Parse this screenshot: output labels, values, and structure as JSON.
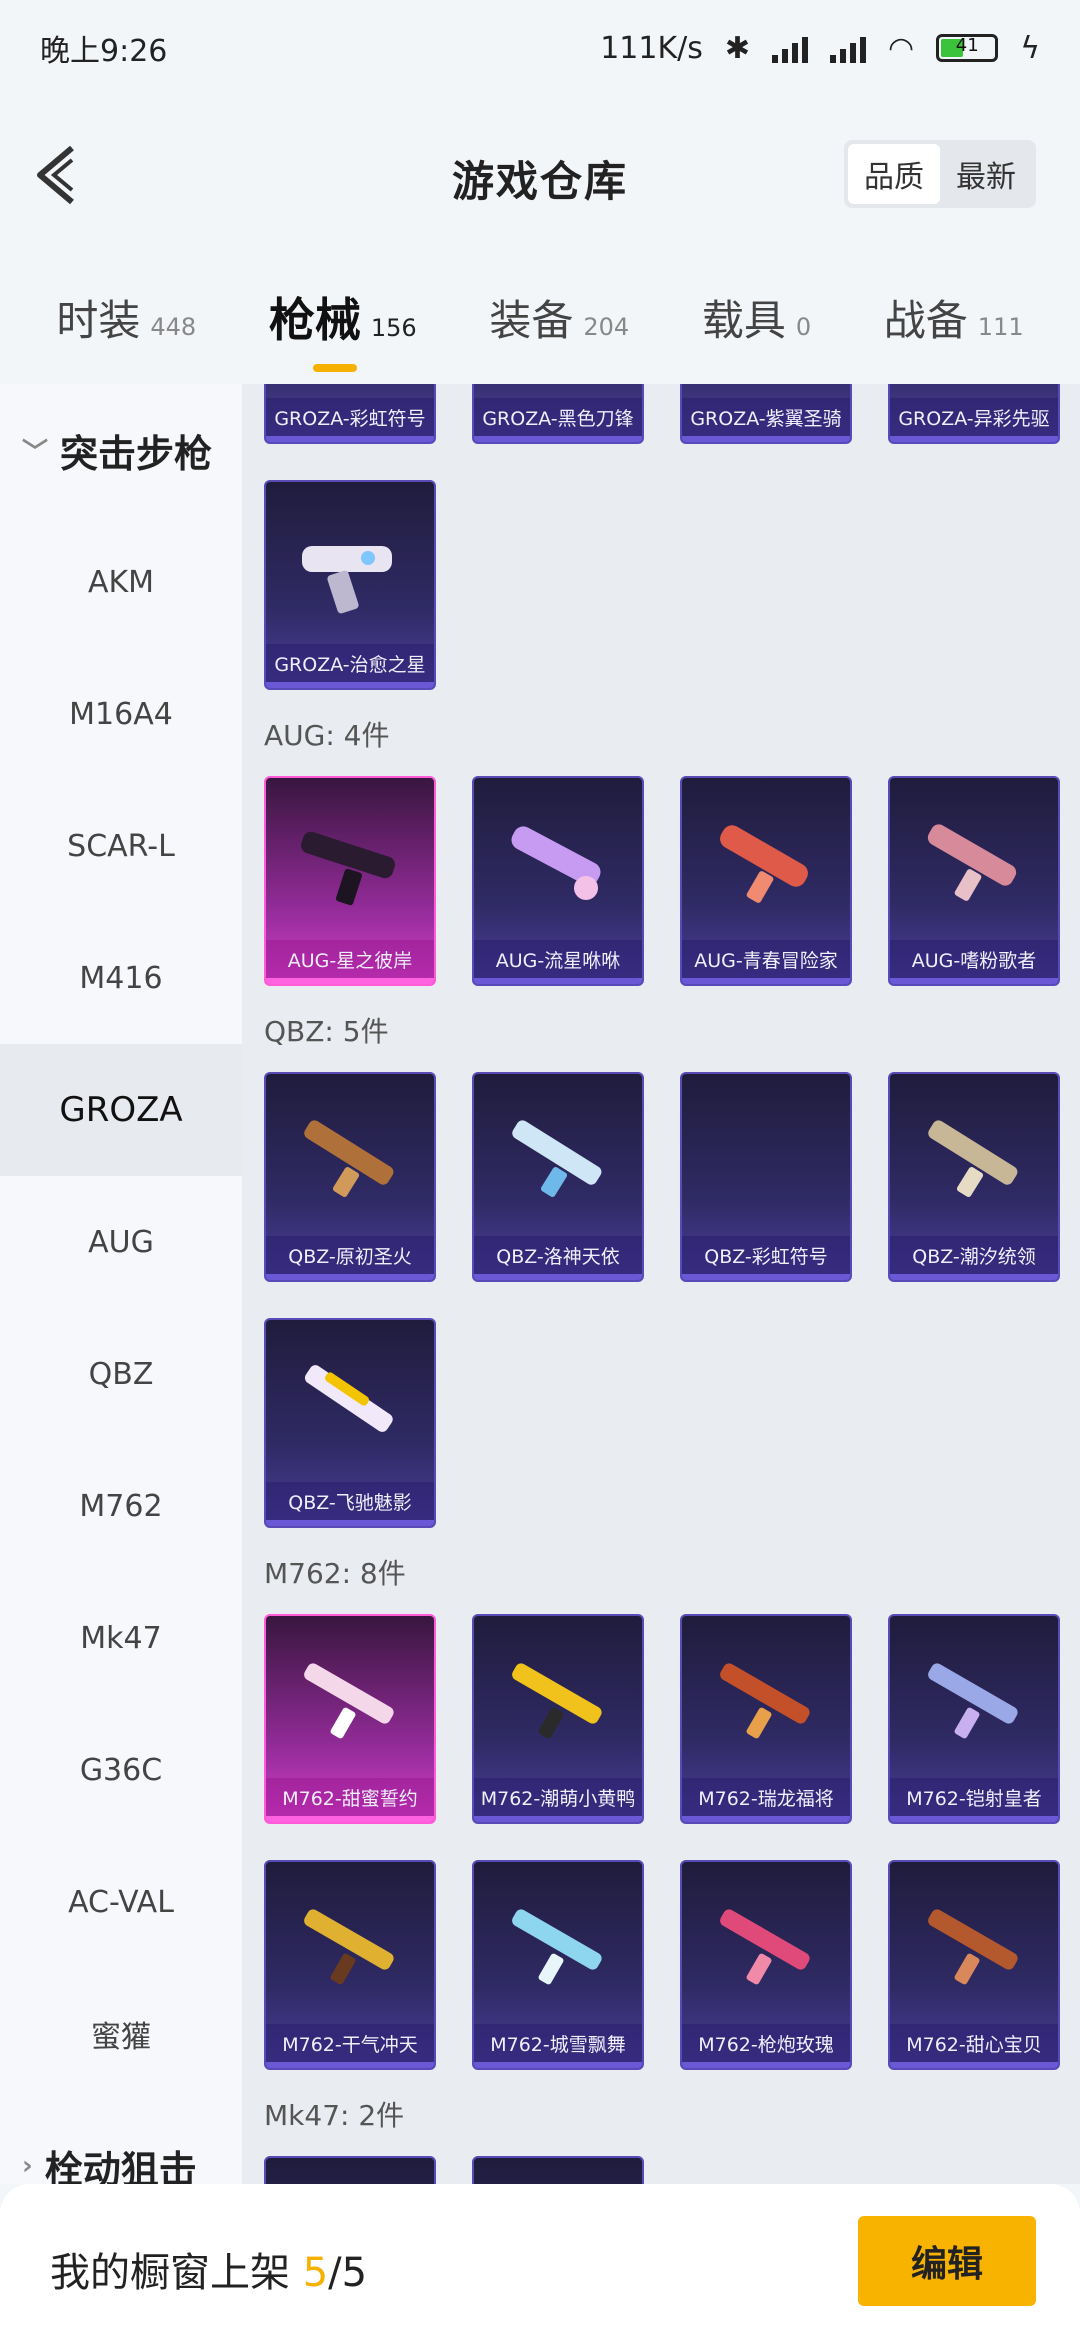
{
  "status_bar": {
    "time": "晚上9:26",
    "speed": "111K/s",
    "battery": "41"
  },
  "header": {
    "title": "游戏仓库",
    "toggle": [
      "品质",
      "最新"
    ]
  },
  "tabs": [
    {
      "label": "时装",
      "count": "448"
    },
    {
      "label": "枪械",
      "count": "156"
    },
    {
      "label": "装备",
      "count": "204"
    },
    {
      "label": "载具",
      "count": "0"
    },
    {
      "label": "战备",
      "count": "111"
    }
  ],
  "sidebar": {
    "category_open": "突击步枪",
    "items": [
      "AKM",
      "M16A4",
      "SCAR-L",
      "M416",
      "GROZA",
      "AUG",
      "QBZ",
      "M762",
      "Mk47",
      "G36C",
      "AC-VAL",
      "蜜獾"
    ],
    "category_next": "栓动狙击"
  },
  "sections": {
    "groza_top": [
      "GROZA-彩虹符号",
      "GROZA-黑色刀锋",
      "GROZA-紫翼圣骑",
      "GROZA-异彩先驱"
    ],
    "groza_extra": [
      "GROZA-治愈之星"
    ],
    "aug_title": "AUG: 4件",
    "aug": [
      "AUG-星之彼岸",
      "AUG-流星咻咻",
      "AUG-青春冒险家",
      "AUG-嗜粉歌者"
    ],
    "qbz_title": "QBZ: 5件",
    "qbz": [
      "QBZ-原初圣火",
      "QBZ-洛神天依",
      "QBZ-彩虹符号",
      "QBZ-潮汐统领"
    ],
    "qbz_extra": [
      "QBZ-飞驰魅影"
    ],
    "m762_title": "M762: 8件",
    "m762_row1": [
      "M762-甜蜜誓约",
      "M762-潮萌小黄鸭",
      "M762-瑞龙福将",
      "M762-铠射皇者"
    ],
    "m762_row2": [
      "M762-干气冲天",
      "M762-城雪飘舞",
      "M762-枪炮玫瑰",
      "M762-甜心宝贝"
    ],
    "mk47_title": "Mk47: 2件"
  },
  "bottom": {
    "label": "我的橱窗上架",
    "count": "5",
    "total": "/5",
    "edit": "编辑"
  },
  "colors": {
    "accent": "#f6b100",
    "card_blue": "#4c3e9a",
    "card_pink": "#d13ec8"
  }
}
